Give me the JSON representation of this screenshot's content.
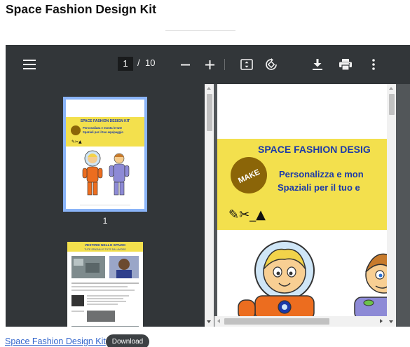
{
  "page": {
    "title": "Space Fashion Design Kit"
  },
  "viewer": {
    "current_page": "1",
    "page_separator": "/",
    "total_pages": "10",
    "icons": {
      "menu": "menu-icon",
      "zoom_out": "minus-icon",
      "zoom_in": "plus-icon",
      "fit": "fit-to-page-icon",
      "rotate": "rotate-icon",
      "download": "download-icon",
      "print": "print-icon",
      "more": "more-vert-icon"
    },
    "thumbnails": [
      {
        "label": "1"
      }
    ]
  },
  "document": {
    "cover_title": "SPACE FASHION DESIG",
    "badge": "MAKE",
    "subtitle_line1": "Personalizza e mon",
    "subtitle_line2": "Spaziali per il tuo e",
    "thumb1_title": "SPACE FASHION DESIGN KIT",
    "thumb1_sub1": "Personalizza e monta le tute",
    "thumb1_sub2": "Spaziali per il tuo equipaggio",
    "thumb2_title": "VESTIRSI NELLO SPAZIO",
    "thumb2_sub": "TUTE SPAZIALI E TUTE DA LAVORO"
  },
  "footer": {
    "link_label": "Space Fashion Design Kit",
    "download_label": "Download"
  },
  "colors": {
    "toolbar": "#323639",
    "sidebar": "#323639",
    "viewer_bg": "#525659",
    "cover_yellow": "#f3e04d",
    "cover_blue": "#1c3aa9",
    "badge": "#8b6508",
    "thumb_border": "#8ab4f8"
  }
}
